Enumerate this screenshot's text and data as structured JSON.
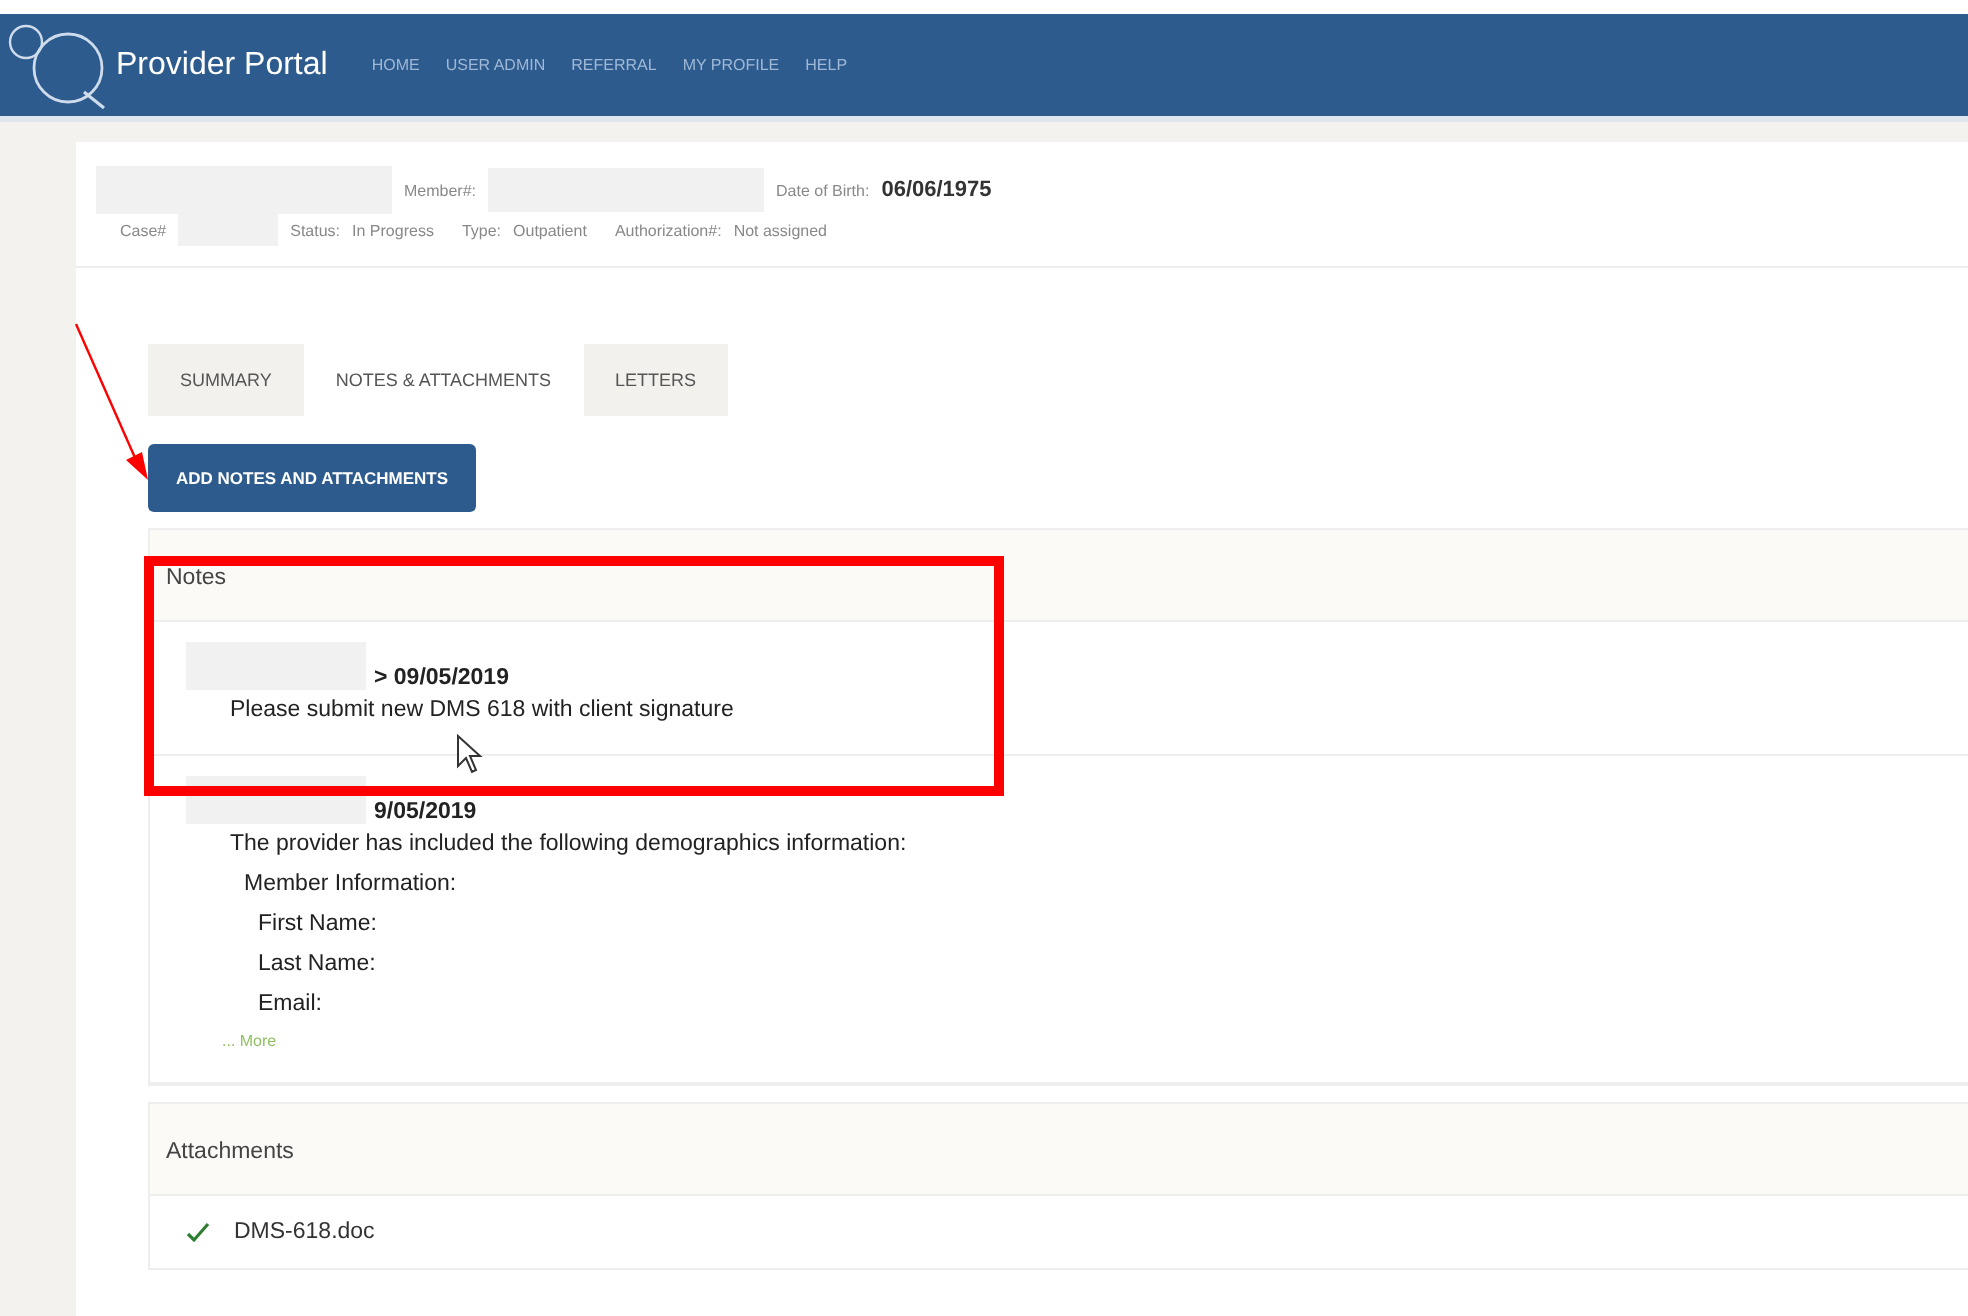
{
  "header": {
    "title": "Provider Portal",
    "nav": [
      {
        "label": "HOME"
      },
      {
        "label": "USER ADMIN"
      },
      {
        "label": "REFERRAL"
      },
      {
        "label": "MY PROFILE"
      },
      {
        "label": "HELP"
      }
    ]
  },
  "case": {
    "member_label": "Member#:",
    "dob_label": "Date of Birth:",
    "dob": "06/06/1975",
    "case_label": "Case#",
    "status_label": "Status:",
    "status": "In Progress",
    "type_label": "Type:",
    "type": "Outpatient",
    "auth_label": "Authorization#:",
    "auth": "Not assigned"
  },
  "tabs": [
    {
      "label": "SUMMARY",
      "selected": false
    },
    {
      "label": "NOTES & ATTACHMENTS",
      "selected": true
    },
    {
      "label": "LETTERS",
      "selected": false
    }
  ],
  "add_button": "ADD NOTES AND ATTACHMENTS",
  "notes": {
    "title": "Notes",
    "items": [
      {
        "date": "> 09/05/2019",
        "lines": [
          {
            "text": "Please submit new DMS 618 with client signature"
          }
        ]
      },
      {
        "date": "9/05/2019",
        "lines": [
          {
            "text": "The provider has included the following demographics information:",
            "children": [
              {
                "text": "Member Information:",
                "children": [
                  {
                    "text": "First Name:"
                  },
                  {
                    "text": "Last Name:"
                  },
                  {
                    "text": "Email:"
                  }
                ]
              }
            ]
          }
        ],
        "more": "... More"
      }
    ]
  },
  "attachments": {
    "title": "Attachments",
    "items": [
      {
        "name": "DMS-618.doc",
        "checked": true
      }
    ]
  }
}
